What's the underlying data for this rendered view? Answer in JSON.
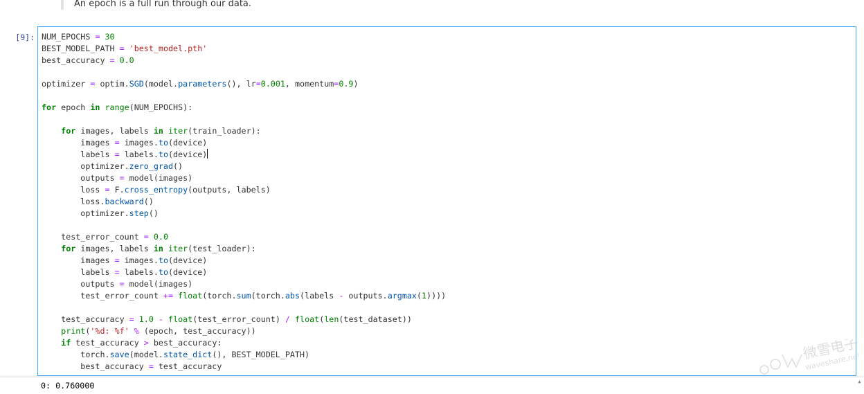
{
  "markdown": {
    "quote_text": "An epoch is a full run through our data."
  },
  "cell": {
    "prompt": "[9]:",
    "lines": [
      "NUM_EPOCHS = 30",
      "BEST_MODEL_PATH = 'best_model.pth'",
      "best_accuracy = 0.0",
      "",
      "optimizer = optim.SGD(model.parameters(), lr=0.001, momentum=0.9)",
      "",
      "for epoch in range(NUM_EPOCHS):",
      "",
      "    for images, labels in iter(train_loader):",
      "        images = images.to(device)",
      "        labels = labels.to(device)",
      "        optimizer.zero_grad()",
      "        outputs = model(images)",
      "        loss = F.cross_entropy(outputs, labels)",
      "        loss.backward()",
      "        optimizer.step()",
      "",
      "    test_error_count = 0.0",
      "    for images, labels in iter(test_loader):",
      "        images = images.to(device)",
      "        labels = labels.to(device)",
      "        outputs = model(images)",
      "        test_error_count += float(torch.sum(torch.abs(labels - outputs.argmax(1))))",
      "",
      "    test_accuracy = 1.0 - float(test_error_count) / float(len(test_dataset))",
      "    print('%d: %f' % (epoch, test_accuracy))",
      "    if test_accuracy > best_accuracy:",
      "        torch.save(model.state_dict(), BEST_MODEL_PATH)",
      "        best_accuracy = test_accuracy"
    ]
  },
  "output": {
    "text": "0: 0.760000"
  },
  "watermark": {
    "text": "微雪电子",
    "subtext": "waveshare.net"
  },
  "colors": {
    "cell_border": "#42a5f5",
    "prompt": "#303f9f",
    "keyword": "#008000",
    "string": "#ba2121",
    "operator": "#aa22ff"
  }
}
